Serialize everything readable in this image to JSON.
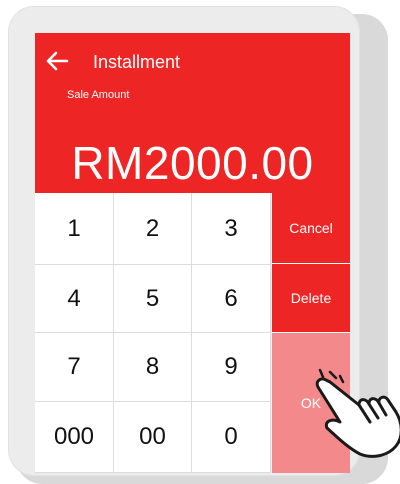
{
  "header": {
    "title": "Installment",
    "label": "Sale Amount",
    "amount": "RM2000.00",
    "back_icon": "arrow-left-icon"
  },
  "keypad": {
    "keys": [
      "1",
      "2",
      "3",
      "4",
      "5",
      "6",
      "7",
      "8",
      "9",
      "000",
      "00",
      "0"
    ],
    "cancel": "Cancel",
    "delete": "Delete",
    "ok": "OK"
  },
  "colors": {
    "primary": "#ee2525",
    "ok_disabled": "#f4898c",
    "frame": "#ececec"
  },
  "overlay": {
    "pointer_icon": "hand-pointer-icon"
  }
}
